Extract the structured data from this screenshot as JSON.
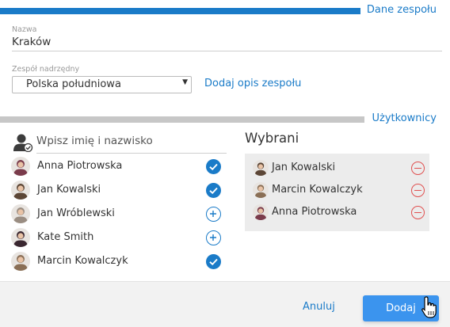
{
  "sections": {
    "team": "Dane zespołu",
    "users": "Użytkownicy"
  },
  "name_field": {
    "label": "Nazwa",
    "value": "Kraków"
  },
  "parent_field": {
    "label": "Zespół nadrzędny",
    "value": "Polska południowa"
  },
  "add_description_link": "Dodaj opis zespołu",
  "search": {
    "placeholder": "Wpisz imię i nazwisko",
    "icon": "user-icon"
  },
  "users": [
    {
      "name": "Anna Piotrowska",
      "state": "checked",
      "avatar_color": "#7a3b4b"
    },
    {
      "name": "Jan Kowalski",
      "state": "checked",
      "avatar_color": "#5c4636"
    },
    {
      "name": "Jan Wróblewski",
      "state": "add",
      "avatar_color": "#9a8d82"
    },
    {
      "name": "Kate Smith",
      "state": "add",
      "avatar_color": "#3a2730"
    },
    {
      "name": "Marcin Kowalczyk",
      "state": "checked",
      "avatar_color": "#8a6f56"
    }
  ],
  "selected": {
    "title": "Wybrani",
    "items": [
      {
        "name": "Jan Kowalski",
        "avatar_color": "#5c4636"
      },
      {
        "name": "Marcin Kowalczyk",
        "avatar_color": "#8a6f56"
      },
      {
        "name": "Anna Piotrowska",
        "avatar_color": "#7a3b4b"
      }
    ]
  },
  "footer": {
    "cancel": "Anuluj",
    "submit": "Dodaj"
  },
  "colors": {
    "accent": "#1a7bc8",
    "button": "#3b94ee",
    "remove": "#e05050"
  }
}
